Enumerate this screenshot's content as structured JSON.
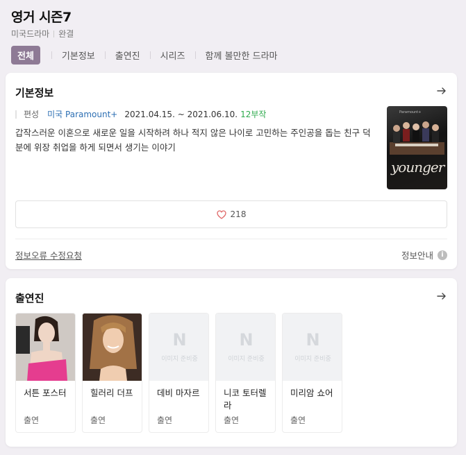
{
  "header": {
    "title": "영거 시즌7",
    "genre": "미국드라마",
    "status": "완결"
  },
  "tabs": [
    {
      "label": "전체",
      "active": true
    },
    {
      "label": "기본정보"
    },
    {
      "label": "출연진"
    },
    {
      "label": "시리즈"
    },
    {
      "label": "함께 볼만한 드라마"
    }
  ],
  "basic_info": {
    "title": "기본정보",
    "label": "편성",
    "country": "미국",
    "network": "Paramount+",
    "date_range": "2021.04.15. ~ 2021.06.10.",
    "episodes": "12부작",
    "description": "갑작스러운 이혼으로 새로운 일을 시작하려 하나 적지 않은 나이로 고민하는 주인공을 돕는 친구 덕분에 위장 취업을 하게 되면서 생기는 이야기",
    "poster": {
      "top_logo": "Paramount+",
      "brand": "younger"
    },
    "likes": "218",
    "report_link": "정보오류 수정요청",
    "info_guide": "정보안내",
    "info_icon": "i"
  },
  "cast": {
    "title": "출연진",
    "no_image_logo": "N",
    "no_image_text": "이미지 준비중",
    "members": [
      {
        "name": "서튼 포스터",
        "role": "출연",
        "photo": "photo-1"
      },
      {
        "name": "힐러리 더프",
        "role": "출연",
        "photo": "photo-2"
      },
      {
        "name": "데비 마자르",
        "role": "출연",
        "photo": "none"
      },
      {
        "name": "니코 토터렐라",
        "role": "출연",
        "photo": "none"
      },
      {
        "name": "미리암 쇼어",
        "role": "출연",
        "photo": "none"
      }
    ]
  },
  "colors": {
    "active_tab_bg": "#8e7a95",
    "page_bg": "#f1eef3",
    "link_blue": "#2d6fb3",
    "episode_green": "#2eaa4d",
    "heart": "#e06a6a"
  }
}
